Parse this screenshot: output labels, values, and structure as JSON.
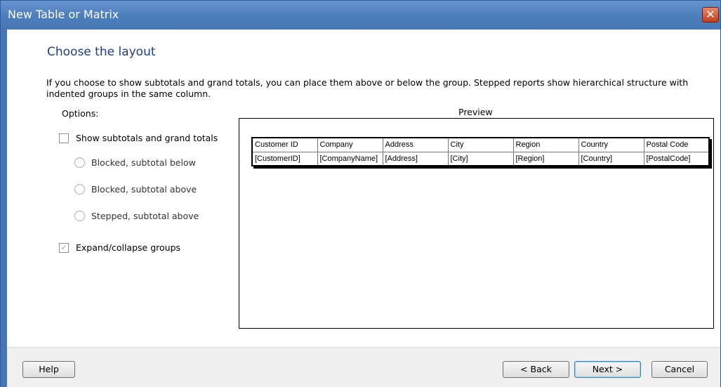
{
  "window": {
    "title": "New Table or Matrix"
  },
  "page": {
    "heading": "Choose the layout",
    "description": "If you choose to show subtotals and grand totals, you can place them above or below the group. Stepped reports show hierarchical structure with indented groups in the same column."
  },
  "options": {
    "label": "Options:",
    "show_subtotals": {
      "label": "Show subtotals and grand totals",
      "checked": false
    },
    "radios": [
      {
        "label": "Blocked, subtotal below"
      },
      {
        "label": "Blocked, subtotal above"
      },
      {
        "label": "Stepped, subtotal above"
      }
    ],
    "expand_collapse": {
      "label": "Expand/collapse groups",
      "checked": true,
      "check_mark": "✓"
    }
  },
  "preview": {
    "label": "Preview",
    "headers": [
      "Customer ID",
      "Company",
      "Address",
      "City",
      "Region",
      "Country",
      "Postal Code"
    ],
    "row": [
      "[CustomerID]",
      "[CompanyName]",
      "[Address]",
      "[City]",
      "[Region]",
      "[Country]",
      "[PostalCode]"
    ]
  },
  "buttons": {
    "help": "Help",
    "back": "< Back",
    "next": "Next >",
    "cancel": "Cancel",
    "close": "✕"
  },
  "colors": {
    "title_bar": "#4e7fbd",
    "heading": "#1e3d8c",
    "close_button": "#c5401c"
  }
}
